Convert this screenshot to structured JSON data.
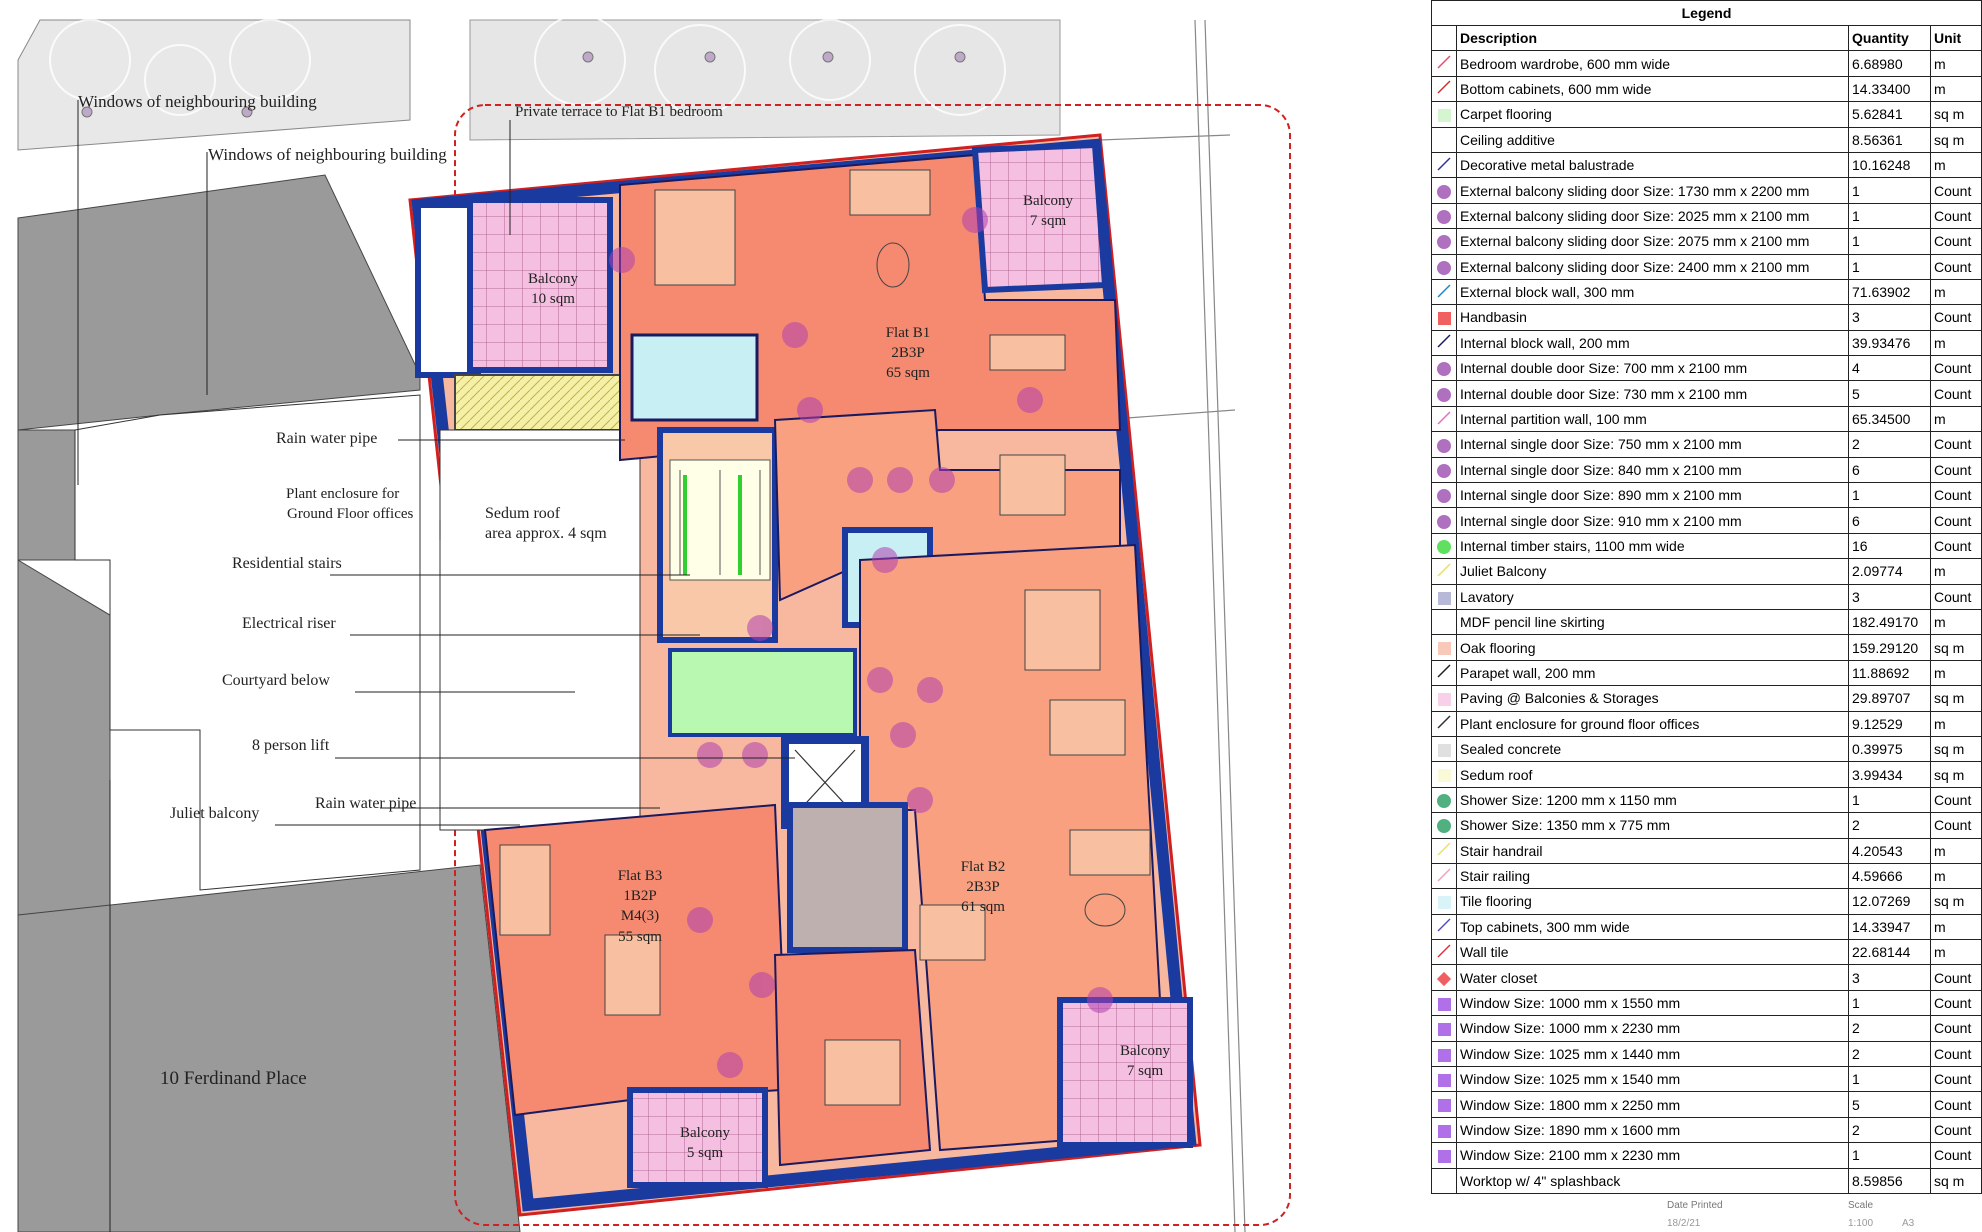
{
  "plan": {
    "labels": {
      "windows_1": "Windows of neighbouring building",
      "windows_2": "Windows of neighbouring building",
      "terrace": "Private terrace to Flat B1 bedroom",
      "rainpipe_1": "Rain water pipe",
      "plant_1": "Plant enclosure for",
      "plant_2": "Ground Floor offices",
      "sedum_1": "Sedum roof",
      "sedum_2": "area approx. 4 sqm",
      "stairs": "Residential stairs",
      "riser": "Electrical riser",
      "courtyard": "Courtyard below",
      "lift": "8 person lift",
      "juliet": "Juliet balcony",
      "rainpipe_2": "Rain water pipe",
      "ferdinand": "10 Ferdinand Place"
    },
    "rooms": {
      "balcony_10": [
        "Balcony",
        "10 sqm"
      ],
      "balcony_7a": [
        "Balcony",
        "7 sqm"
      ],
      "flat_b1": [
        "Flat B1",
        "2B3P",
        "65 sqm"
      ],
      "flat_b3": [
        "Flat B3",
        "1B2P",
        "M4(3)",
        "55 sqm"
      ],
      "flat_b2": [
        "Flat B2",
        "2B3P",
        "61 sqm"
      ],
      "balcony_7b": [
        "Balcony",
        "7 sqm"
      ],
      "balcony_5": [
        "Balcony",
        "5 sqm"
      ]
    }
  },
  "legend": {
    "title": "Legend",
    "headers": {
      "description": "Description",
      "quantity": "Quantity",
      "unit": "Unit"
    },
    "rows": [
      {
        "swatch": "line",
        "color": "#e0506a",
        "description": "Bedroom wardrobe, 600 mm wide",
        "quantity": "6.68980",
        "unit": "m"
      },
      {
        "swatch": "line",
        "color": "#d03030",
        "description": "Bottom cabinets, 600 mm wide",
        "quantity": "14.33400",
        "unit": "m"
      },
      {
        "swatch": "square",
        "color": "#d4f5d0",
        "description": "Carpet flooring",
        "quantity": "5.62841",
        "unit": "sq m"
      },
      {
        "swatch": "none",
        "color": "#ffffff",
        "description": "Ceiling additive",
        "quantity": "8.56361",
        "unit": "sq m"
      },
      {
        "swatch": "line",
        "color": "#3030a0",
        "description": "Decorative metal balustrade",
        "quantity": "10.16248",
        "unit": "m"
      },
      {
        "swatch": "dot",
        "color": "#b070c0",
        "description": "External balcony sliding door Size: 1730 mm x 2200 mm",
        "quantity": "1",
        "unit": "Count"
      },
      {
        "swatch": "dot",
        "color": "#b070c0",
        "description": "External balcony sliding door Size: 2025 mm x 2100 mm",
        "quantity": "1",
        "unit": "Count"
      },
      {
        "swatch": "dot",
        "color": "#b070c0",
        "description": "External balcony sliding door Size: 2075 mm x 2100 mm",
        "quantity": "1",
        "unit": "Count"
      },
      {
        "swatch": "dot",
        "color": "#b070c0",
        "description": "External balcony sliding door Size: 2400 mm x 2100 mm",
        "quantity": "1",
        "unit": "Count"
      },
      {
        "swatch": "line",
        "color": "#1a8ac0",
        "description": "External block wall, 300 mm",
        "quantity": "71.63902",
        "unit": "m"
      },
      {
        "swatch": "square",
        "color": "#f06060",
        "description": "Handbasin",
        "quantity": "3",
        "unit": "Count"
      },
      {
        "swatch": "line",
        "color": "#1a1a60",
        "description": "Internal block wall, 200 mm",
        "quantity": "39.93476",
        "unit": "m"
      },
      {
        "swatch": "dot",
        "color": "#b070c0",
        "description": "Internal double door Size: 700 mm x 2100 mm",
        "quantity": "4",
        "unit": "Count"
      },
      {
        "swatch": "dot",
        "color": "#b070c0",
        "description": "Internal double door Size: 730 mm x 2100 mm",
        "quantity": "5",
        "unit": "Count"
      },
      {
        "swatch": "line",
        "color": "#e070c0",
        "description": "Internal partition wall, 100 mm",
        "quantity": "65.34500",
        "unit": "m"
      },
      {
        "swatch": "dot",
        "color": "#b070c0",
        "description": "Internal single door Size: 750 mm x 2100 mm",
        "quantity": "2",
        "unit": "Count"
      },
      {
        "swatch": "dot",
        "color": "#b070c0",
        "description": "Internal single door Size: 840 mm x 2100 mm",
        "quantity": "6",
        "unit": "Count"
      },
      {
        "swatch": "dot",
        "color": "#b070c0",
        "description": "Internal single door Size: 890 mm x 2100 mm",
        "quantity": "1",
        "unit": "Count"
      },
      {
        "swatch": "dot",
        "color": "#b070c0",
        "description": "Internal single door Size: 910 mm x 2100 mm",
        "quantity": "6",
        "unit": "Count"
      },
      {
        "swatch": "dot",
        "color": "#60e060",
        "description": "Internal timber stairs, 1100 mm wide",
        "quantity": "16",
        "unit": "Count"
      },
      {
        "swatch": "line",
        "color": "#e8e060",
        "description": "Juliet Balcony",
        "quantity": "2.09774",
        "unit": "m"
      },
      {
        "swatch": "square",
        "color": "#b8b8d8",
        "description": "Lavatory",
        "quantity": "3",
        "unit": "Count"
      },
      {
        "swatch": "none",
        "color": "#ffffff",
        "description": "MDF pencil line skirting",
        "quantity": "182.49170",
        "unit": "m"
      },
      {
        "swatch": "square",
        "color": "#f8c8b8",
        "description": "Oak flooring",
        "quantity": "159.29120",
        "unit": "sq m"
      },
      {
        "swatch": "line",
        "color": "#202020",
        "description": "Parapet wall, 200 mm",
        "quantity": "11.88692",
        "unit": "m"
      },
      {
        "swatch": "square",
        "color": "#f8d0e8",
        "description": "Paving @ Balconies & Storages",
        "quantity": "29.89707",
        "unit": "sq m"
      },
      {
        "swatch": "line",
        "color": "#303030",
        "description": "Plant enclosure for ground floor offices",
        "quantity": "9.12529",
        "unit": "m"
      },
      {
        "swatch": "square",
        "color": "#e0e0e0",
        "description": "Sealed concrete",
        "quantity": "0.39975",
        "unit": "sq m"
      },
      {
        "swatch": "square",
        "color": "#fafad8",
        "description": "Sedum roof",
        "quantity": "3.99434",
        "unit": "sq m"
      },
      {
        "swatch": "dot",
        "color": "#50b080",
        "description": "Shower Size: 1200 mm x 1150 mm",
        "quantity": "1",
        "unit": "Count"
      },
      {
        "swatch": "dot",
        "color": "#50b080",
        "description": "Shower Size: 1350 mm x 775 mm",
        "quantity": "2",
        "unit": "Count"
      },
      {
        "swatch": "line",
        "color": "#e8e070",
        "description": "Stair handrail",
        "quantity": "4.20543",
        "unit": "m"
      },
      {
        "swatch": "line",
        "color": "#f0a0c0",
        "description": "Stair railing",
        "quantity": "4.59666",
        "unit": "m"
      },
      {
        "swatch": "square",
        "color": "#d8f4f8",
        "description": "Tile flooring",
        "quantity": "12.07269",
        "unit": "sq m"
      },
      {
        "swatch": "line",
        "color": "#5050c0",
        "description": "Top cabinets, 300 mm wide",
        "quantity": "14.33947",
        "unit": "m"
      },
      {
        "swatch": "line",
        "color": "#e03040",
        "description": "Wall tile",
        "quantity": "22.68144",
        "unit": "m"
      },
      {
        "swatch": "diamond",
        "color": "#f06060",
        "description": "Water closet",
        "quantity": "3",
        "unit": "Count"
      },
      {
        "swatch": "square",
        "color": "#b070e8",
        "description": "Window Size: 1000 mm x 1550 mm",
        "quantity": "1",
        "unit": "Count"
      },
      {
        "swatch": "square",
        "color": "#b070e8",
        "description": "Window Size: 1000 mm x 2230 mm",
        "quantity": "2",
        "unit": "Count"
      },
      {
        "swatch": "square",
        "color": "#b070e8",
        "description": "Window Size: 1025 mm x 1440 mm",
        "quantity": "2",
        "unit": "Count"
      },
      {
        "swatch": "square",
        "color": "#b070e8",
        "description": "Window Size: 1025 mm x 1540 mm",
        "quantity": "1",
        "unit": "Count"
      },
      {
        "swatch": "square",
        "color": "#b070e8",
        "description": "Window Size: 1800 mm x 2250 mm",
        "quantity": "5",
        "unit": "Count"
      },
      {
        "swatch": "square",
        "color": "#b070e8",
        "description": "Window Size: 1890 mm x 1600 mm",
        "quantity": "2",
        "unit": "Count"
      },
      {
        "swatch": "square",
        "color": "#b070e8",
        "description": "Window Size: 2100 mm x 2230 mm",
        "quantity": "1",
        "unit": "Count"
      },
      {
        "swatch": "none",
        "color": "#ffffff",
        "description": "Worktop w/ 4\" splashback",
        "quantity": "8.59856",
        "unit": "sq m"
      }
    ]
  },
  "footer": {
    "date_label": "Date Printed",
    "date_value": "18/2/21",
    "scale_label": "Scale",
    "scale_value": "1:100",
    "paper": "A3"
  }
}
